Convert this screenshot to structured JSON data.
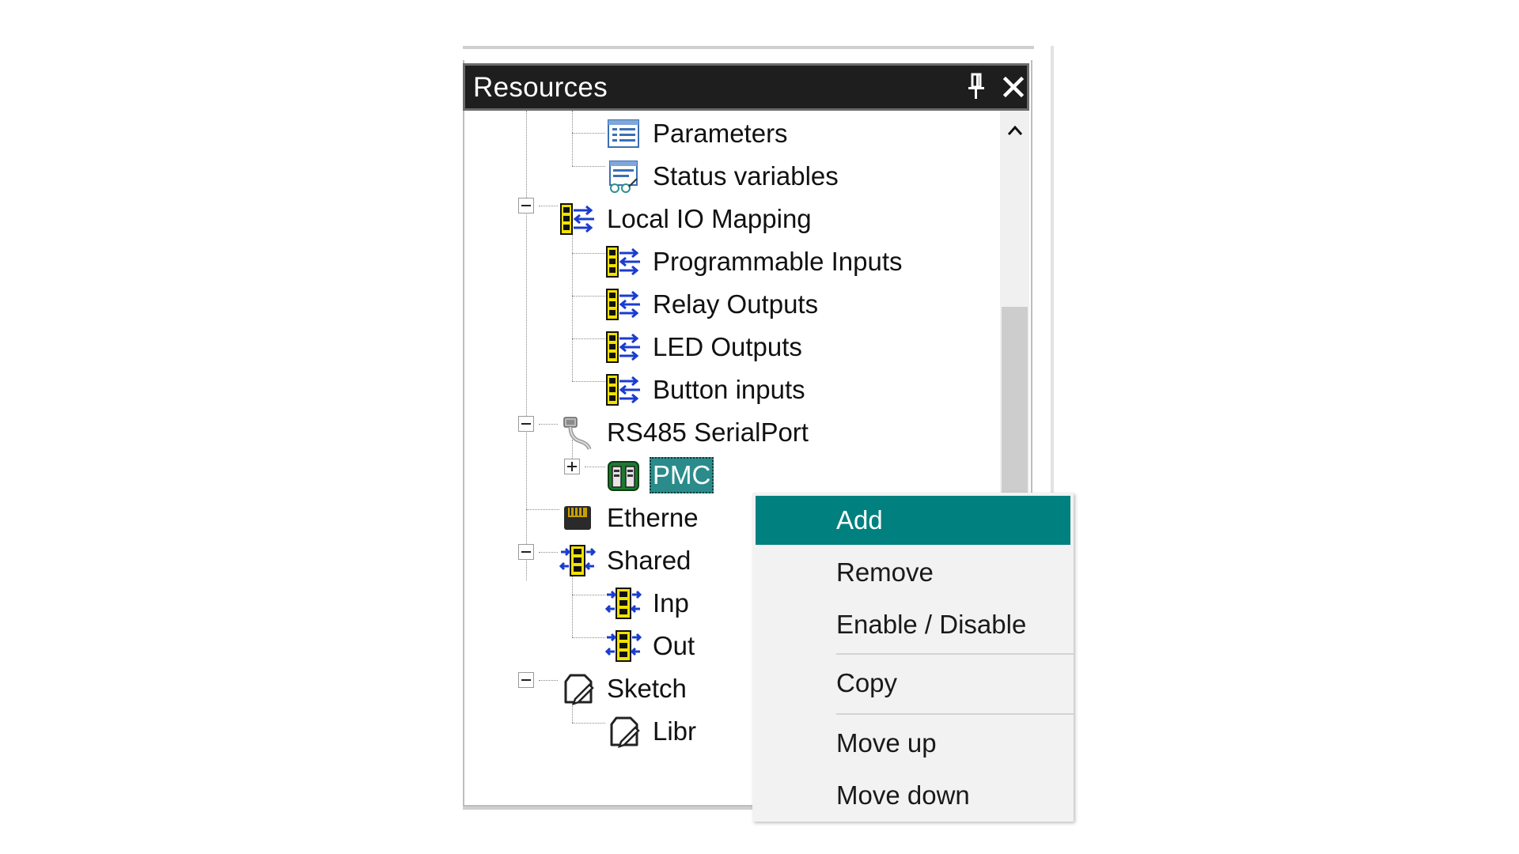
{
  "panel": {
    "title": "Resources",
    "pin_icon": "pin-icon",
    "close_icon": "close-icon"
  },
  "tree": {
    "items": [
      {
        "label": "Parameters",
        "icon": "parameters-icon",
        "level": 2
      },
      {
        "label": "Status variables",
        "icon": "status-variables-icon",
        "level": 2
      },
      {
        "label": "Local IO Mapping",
        "icon": "io-mapping-icon",
        "level": 1,
        "expanded": true
      },
      {
        "label": "Programmable Inputs",
        "icon": "io-mapping-icon",
        "level": 2
      },
      {
        "label": "Relay Outputs",
        "icon": "io-mapping-icon",
        "level": 2
      },
      {
        "label": "LED Outputs",
        "icon": "io-mapping-icon",
        "level": 2
      },
      {
        "label": "Button inputs",
        "icon": "io-mapping-icon",
        "level": 2
      },
      {
        "label": "RS485 SerialPort",
        "icon": "serial-port-icon",
        "level": 1,
        "expanded": true
      },
      {
        "label": "PMC",
        "icon": "pmc-device-icon",
        "level": 2,
        "expanded": false,
        "selected": true
      },
      {
        "label": "Etherne",
        "icon": "ethernet-icon",
        "level": 1
      },
      {
        "label": "Shared",
        "icon": "shared-io-icon",
        "level": 1,
        "expanded": true
      },
      {
        "label": "Inp",
        "icon": "shared-io-icon",
        "level": 2
      },
      {
        "label": "Out",
        "icon": "shared-io-icon",
        "level": 2
      },
      {
        "label": "Sketch",
        "icon": "sketch-icon",
        "level": 1,
        "expanded": true
      },
      {
        "label": "Libr",
        "icon": "sketch-icon",
        "level": 2
      }
    ]
  },
  "context_menu": {
    "items": [
      {
        "label": "Add",
        "active": true
      },
      {
        "label": "Remove"
      },
      {
        "label": "Enable / Disable"
      },
      {
        "label": "Copy"
      },
      {
        "label": "Move up"
      },
      {
        "label": "Move down"
      }
    ]
  },
  "colors": {
    "title_bar": "#1e1e1e",
    "selection": "#2b8b8b",
    "menu_highlight": "#00807f"
  }
}
